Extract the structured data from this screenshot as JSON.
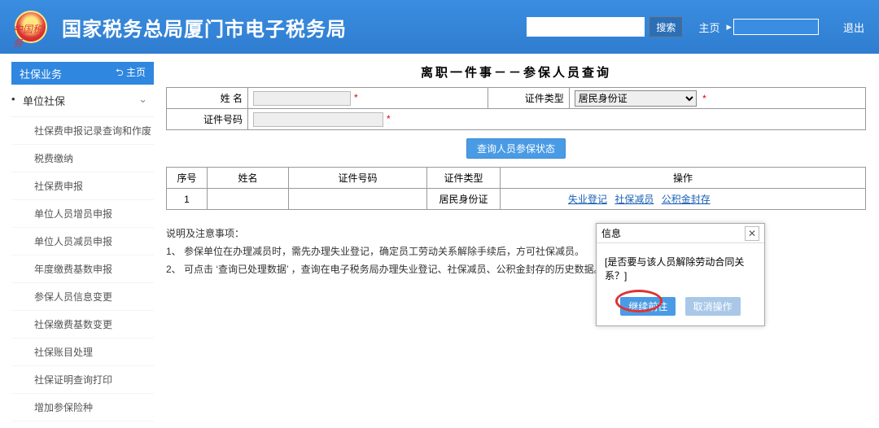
{
  "header": {
    "site_title": "国家税务总局厦门市电子税务局",
    "search_placeholder": "",
    "search_btn": "搜索",
    "home": "主页",
    "logout": "退出"
  },
  "sidebar": {
    "header": "社保业务",
    "home_link": "主页",
    "category": "单位社保",
    "items": [
      "社保费申报记录查询和作废",
      "税费缴纳",
      "社保费申报",
      "单位人员增员申报",
      "单位人员减员申报",
      "年度缴费基数申报",
      "参保人员信息变更",
      "社保缴费基数变更",
      "社保账目处理",
      "社保证明查询打印",
      "增加参保险种"
    ]
  },
  "page": {
    "title": "离职一件事－－参保人员查询",
    "labels": {
      "name": "姓 名",
      "id_type": "证件类型",
      "id_no": "证件号码"
    },
    "id_type_value": "居民身份证",
    "query_btn": "查询人员参保状态"
  },
  "grid": {
    "cols": [
      "序号",
      "姓名",
      "证件号码",
      "证件类型",
      "操作"
    ],
    "row": {
      "seq": "1",
      "name": "",
      "id_no": "",
      "id_type": "居民身份证",
      "ops": [
        "失业登记",
        "社保减员",
        "公积金封存"
      ]
    }
  },
  "notes": {
    "head": "说明及注意事项：",
    "l1": "1、 参保单位在办理减员时，需先办理失业登记，确定员工劳动关系解除手续后，方可社保减员。",
    "l2": "2、 可点击 ‘查询已处理数据’ ，查询在电子税务局办理失业登记、社保减员、公积金封存的历史数据。"
  },
  "modal": {
    "title": "信息",
    "message": "[是否要与该人员解除劳动合同关系？]",
    "ok": "继续前往",
    "cancel": "取消操作"
  }
}
